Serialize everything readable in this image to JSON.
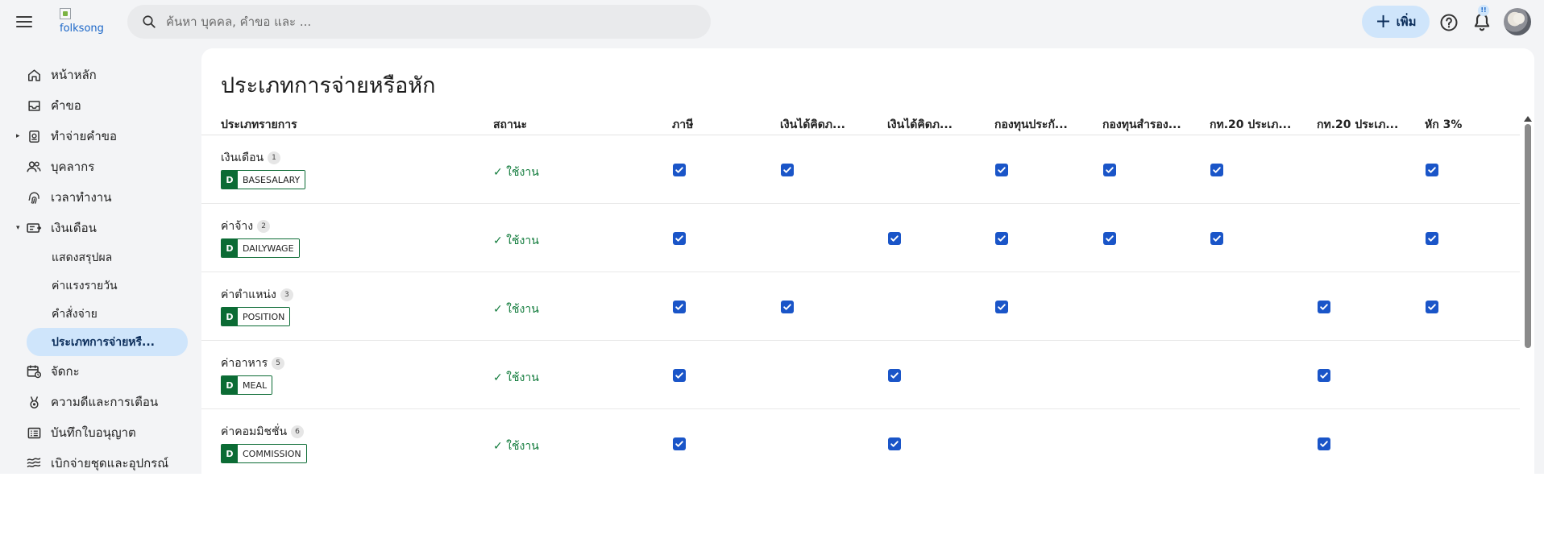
{
  "app": {
    "logo_alt": "folksong",
    "search_placeholder": "ค้นหา บุคคล, คำขอ และ ...",
    "add_label": "เพิ่ม",
    "notif_badge": "!!"
  },
  "sidebar": {
    "items": [
      {
        "label": "หน้าหลัก",
        "icon": "home-icon"
      },
      {
        "label": "คำขอ",
        "icon": "inbox-icon"
      },
      {
        "label": "ทำจ่ายคำขอ",
        "icon": "payout-icon",
        "caret": "▸"
      },
      {
        "label": "บุคลากร",
        "icon": "people-icon"
      },
      {
        "label": "เวลาทำงาน",
        "icon": "fingerprint-icon"
      },
      {
        "label": "เงินเดือน",
        "icon": "payroll-icon",
        "caret": "▾"
      }
    ],
    "sub_items": [
      {
        "label": "แสดงสรุปผล"
      },
      {
        "label": "ค่าแรงรายวัน"
      },
      {
        "label": "คำสั่งจ่าย"
      },
      {
        "label": "ประเภทการจ่ายหรื..."
      }
    ],
    "items_after": [
      {
        "label": "จัดกะ",
        "icon": "calendar-shift-icon"
      },
      {
        "label": "ความดีและการเตือน",
        "icon": "medal-icon"
      },
      {
        "label": "บันทึกใบอนุญาต",
        "icon": "license-icon"
      },
      {
        "label": "เบิกจ่ายชุดและอุปกรณ์",
        "icon": "equipment-icon"
      }
    ]
  },
  "page": {
    "title": "ประเภทการจ่ายหรือหัก"
  },
  "table": {
    "columns": [
      "ประเภทรายการ",
      "สถานะ",
      "ภาษี",
      "เงินได้คิดภ...",
      "เงินได้คิดภ...",
      "กองทุนประกั...",
      "กองทุนสำรอง...",
      "กท.20 ประเภ...",
      "กท.20 ประเภ...",
      "หัก 3%"
    ],
    "rows": [
      {
        "name": "เงินเดือน",
        "num": "1",
        "tag": "D",
        "code": "BASESALARY",
        "status": "✓ ใช้งาน",
        "checks": [
          true,
          true,
          false,
          true,
          true,
          true,
          false,
          true
        ]
      },
      {
        "name": "ค่าจ้าง",
        "num": "2",
        "tag": "D",
        "code": "DAILYWAGE",
        "status": "✓ ใช้งาน",
        "checks": [
          true,
          false,
          true,
          true,
          true,
          true,
          false,
          true
        ]
      },
      {
        "name": "ค่าตำแหน่ง",
        "num": "3",
        "tag": "D",
        "code": "POSITION",
        "status": "✓ ใช้งาน",
        "checks": [
          true,
          true,
          false,
          true,
          false,
          false,
          true,
          true
        ]
      },
      {
        "name": "ค่าอาหาร",
        "num": "5",
        "tag": "D",
        "code": "MEAL",
        "status": "✓ ใช้งาน",
        "checks": [
          true,
          false,
          true,
          false,
          false,
          false,
          true,
          false
        ]
      },
      {
        "name": "ค่าคอมมิชชั่น",
        "num": "6",
        "tag": "D",
        "code": "COMMISSION",
        "status": "✓ ใช้งาน",
        "checks": [
          true,
          false,
          true,
          false,
          false,
          false,
          true,
          false
        ]
      }
    ]
  },
  "colors": {
    "accent": "#1a55c8",
    "active_bg": "#cfe5fb",
    "status_green": "#0f7a3a",
    "tag_green": "#0b6b34"
  }
}
